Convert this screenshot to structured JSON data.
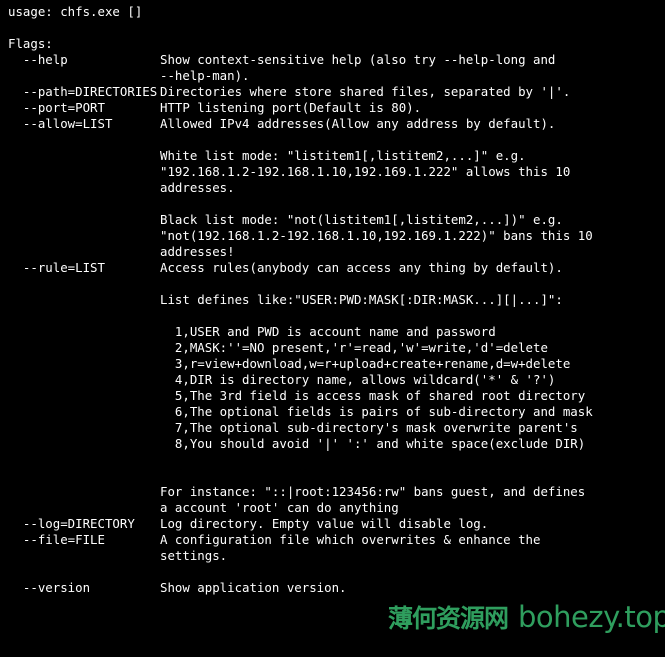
{
  "terminal": {
    "colors": {
      "background": "#000000",
      "foreground": "#ffffff",
      "watermark": "#2f9e5e"
    },
    "usage": "usage: chfs.exe []",
    "flags_header": "Flags:",
    "lines": [
      {
        "flag": "  --help",
        "desc": "Show context-sensitive help (also try --help-long and"
      },
      {
        "flag": "",
        "desc": "--help-man)."
      },
      {
        "flag": "  --path=DIRECTORIES",
        "desc": "Directories where store shared files, separated by '|'."
      },
      {
        "flag": "  --port=PORT",
        "desc": "HTTP listening port(Default is 80)."
      },
      {
        "flag": "  --allow=LIST",
        "desc": "Allowed IPv4 addresses(Allow any address by default)."
      },
      {
        "flag": "",
        "desc": ""
      },
      {
        "flag": "",
        "desc": "White list mode: \"listitem1[,listitem2,...]\" e.g."
      },
      {
        "flag": "",
        "desc": "\"192.168.1.2-192.168.1.10,192.169.1.222\" allows this 10"
      },
      {
        "flag": "",
        "desc": "addresses."
      },
      {
        "flag": "",
        "desc": ""
      },
      {
        "flag": "",
        "desc": "Black list mode: \"not(listitem1[,listitem2,...])\" e.g."
      },
      {
        "flag": "",
        "desc": "\"not(192.168.1.2-192.168.1.10,192.169.1.222)\" bans this 10"
      },
      {
        "flag": "",
        "desc": "addresses!"
      },
      {
        "flag": "  --rule=LIST",
        "desc": "Access rules(anybody can access any thing by default)."
      },
      {
        "flag": "",
        "desc": ""
      },
      {
        "flag": "",
        "desc": "List defines like:\"USER:PWD:MASK[:DIR:MASK...][|...]\":"
      },
      {
        "flag": "",
        "desc": ""
      },
      {
        "flag": "",
        "desc": "  1,USER and PWD is account name and password"
      },
      {
        "flag": "",
        "desc": "  2,MASK:''=NO present,'r'=read,'w'=write,'d'=delete"
      },
      {
        "flag": "",
        "desc": "  3,r=view+download,w=r+upload+create+rename,d=w+delete"
      },
      {
        "flag": "",
        "desc": "  4,DIR is directory name, allows wildcard('*' & '?')"
      },
      {
        "flag": "",
        "desc": "  5,The 3rd field is access mask of shared root directory"
      },
      {
        "flag": "",
        "desc": "  6,The optional fields is pairs of sub-directory and mask"
      },
      {
        "flag": "",
        "desc": "  7,The optional sub-directory's mask overwrite parent's"
      },
      {
        "flag": "",
        "desc": "  8,You should avoid '|' ':' and white space(exclude DIR)"
      },
      {
        "flag": "",
        "desc": ""
      },
      {
        "flag": "",
        "desc": ""
      },
      {
        "flag": "",
        "desc": "For instance: \"::|root:123456:rw\" bans guest, and defines"
      },
      {
        "flag": "",
        "desc": "a account 'root' can do anything"
      },
      {
        "flag": "  --log=DIRECTORY",
        "desc": "Log directory. Empty value will disable log."
      },
      {
        "flag": "  --file=FILE",
        "desc": "A configuration file which overwrites & enhance the"
      },
      {
        "flag": "",
        "desc": "settings."
      },
      {
        "flag": "",
        "desc": ""
      },
      {
        "flag": "  --version",
        "desc": "Show application version."
      }
    ]
  },
  "watermark": {
    "site_name": "薄何资源网",
    "url": "bohezy.top"
  }
}
